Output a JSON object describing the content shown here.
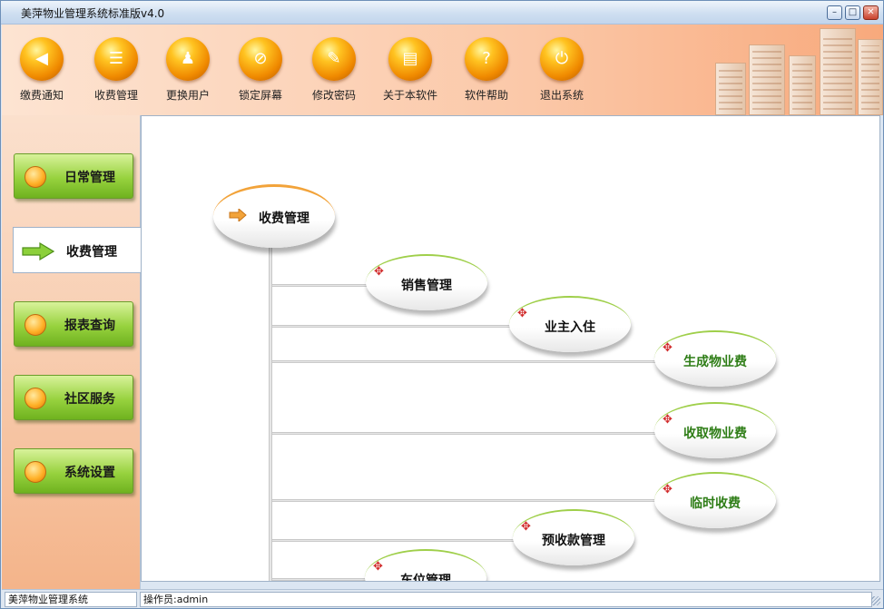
{
  "window": {
    "title": "美萍物业管理系统标准版v4.0",
    "min_label": "–",
    "max_label": "□",
    "close_label": "✕"
  },
  "toolbar": {
    "items": [
      {
        "label": "缴费通知",
        "icon": "megaphone-icon"
      },
      {
        "label": "收费管理",
        "icon": "invoice-icon"
      },
      {
        "label": "更换用户",
        "icon": "user-switch-icon"
      },
      {
        "label": "锁定屏幕",
        "icon": "lock-screen-icon"
      },
      {
        "label": "修改密码",
        "icon": "wrench-key-icon"
      },
      {
        "label": "关于本软件",
        "icon": "document-icon"
      },
      {
        "label": "软件帮助",
        "icon": "question-icon"
      },
      {
        "label": "退出系统",
        "icon": "power-icon"
      }
    ]
  },
  "sidebar": {
    "items": [
      {
        "label": "日常管理",
        "selected": false
      },
      {
        "label": "收费管理",
        "selected": true
      },
      {
        "label": "报表查询",
        "selected": false
      },
      {
        "label": "社区服务",
        "selected": false
      },
      {
        "label": "系统设置",
        "selected": false
      }
    ]
  },
  "tree": {
    "root": "收费管理",
    "nodes": [
      {
        "label": "销售管理"
      },
      {
        "label": "业主入住"
      },
      {
        "label": "生成物业费"
      },
      {
        "label": "收取物业费"
      },
      {
        "label": "临时收费"
      },
      {
        "label": "预收款管理"
      },
      {
        "label": "车位管理"
      }
    ]
  },
  "statusbar": {
    "app_name": "美萍物业管理系统",
    "operator": "操作员:admin"
  },
  "colors": {
    "accent_green": "#8cc63f",
    "node_green_text": "#2e7d16",
    "root_orange": "#f2a33a",
    "toolbar_peach": "#fbc8a8"
  }
}
